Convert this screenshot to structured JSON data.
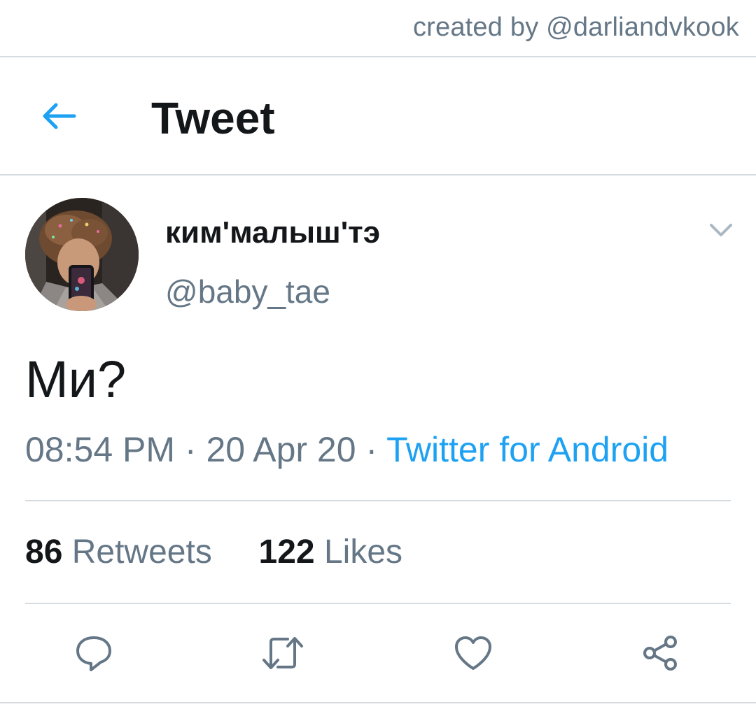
{
  "watermark": "created by @darliandvkook",
  "header": {
    "title": "Tweet",
    "back_icon": "arrow-left-icon"
  },
  "tweet": {
    "display_name": "ким'малыш'тэ",
    "handle": "@baby_tae",
    "text": "Ми?",
    "time": "08:54 PM",
    "separator": "·",
    "date": "20 Apr 20",
    "source": "Twitter for Android",
    "retweets_count": "86",
    "retweets_label": "Retweets",
    "likes_count": "122",
    "likes_label": "Likes"
  },
  "actions": [
    "reply-icon",
    "retweet-icon",
    "like-icon",
    "share-icon"
  ],
  "colors": {
    "accent": "#1da1f2",
    "muted": "#657786",
    "text": "#14171a",
    "divider": "#d6dbe0"
  }
}
